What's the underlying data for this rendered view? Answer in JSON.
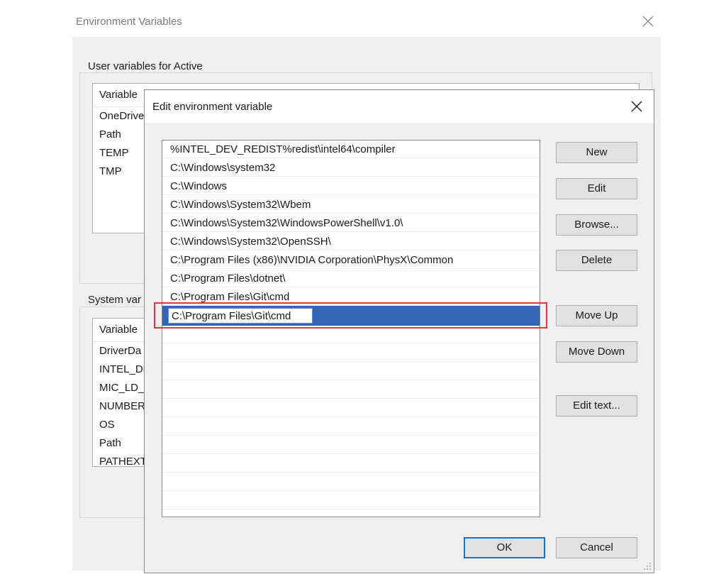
{
  "background_window": {
    "title": "Environment Variables",
    "user_group_label": "User variables for Active",
    "user_list": {
      "header": "Variable",
      "rows": [
        "OneDrive",
        "Path",
        "TEMP",
        "TMP"
      ]
    },
    "system_group_label": "System var",
    "system_list": {
      "header": "Variable",
      "rows": [
        "DriverDa",
        "INTEL_DE",
        "MIC_LD_",
        "NUMBER",
        "OS",
        "Path",
        "PATHEXT"
      ]
    }
  },
  "edit_dialog": {
    "title": "Edit environment variable",
    "paths": [
      "%INTEL_DEV_REDIST%redist\\intel64\\compiler",
      "C:\\Windows\\system32",
      "C:\\Windows",
      "C:\\Windows\\System32\\Wbem",
      "C:\\Windows\\System32\\WindowsPowerShell\\v1.0\\",
      "C:\\Windows\\System32\\OpenSSH\\",
      "C:\\Program Files (x86)\\NVIDIA Corporation\\PhysX\\Common",
      "C:\\Program Files\\dotnet\\",
      "C:\\Program Files\\Git\\cmd"
    ],
    "editing_value": "C:\\Program Files\\Git\\cmd",
    "buttons": {
      "new": "New",
      "edit": "Edit",
      "browse": "Browse...",
      "delete": "Delete",
      "move_up": "Move Up",
      "move_down": "Move Down",
      "edit_text": "Edit text...",
      "ok": "OK",
      "cancel": "Cancel"
    }
  },
  "colors": {
    "selection": "#3266b4",
    "highlight_box": "#e0393c",
    "default_button_border": "#0078d7"
  }
}
